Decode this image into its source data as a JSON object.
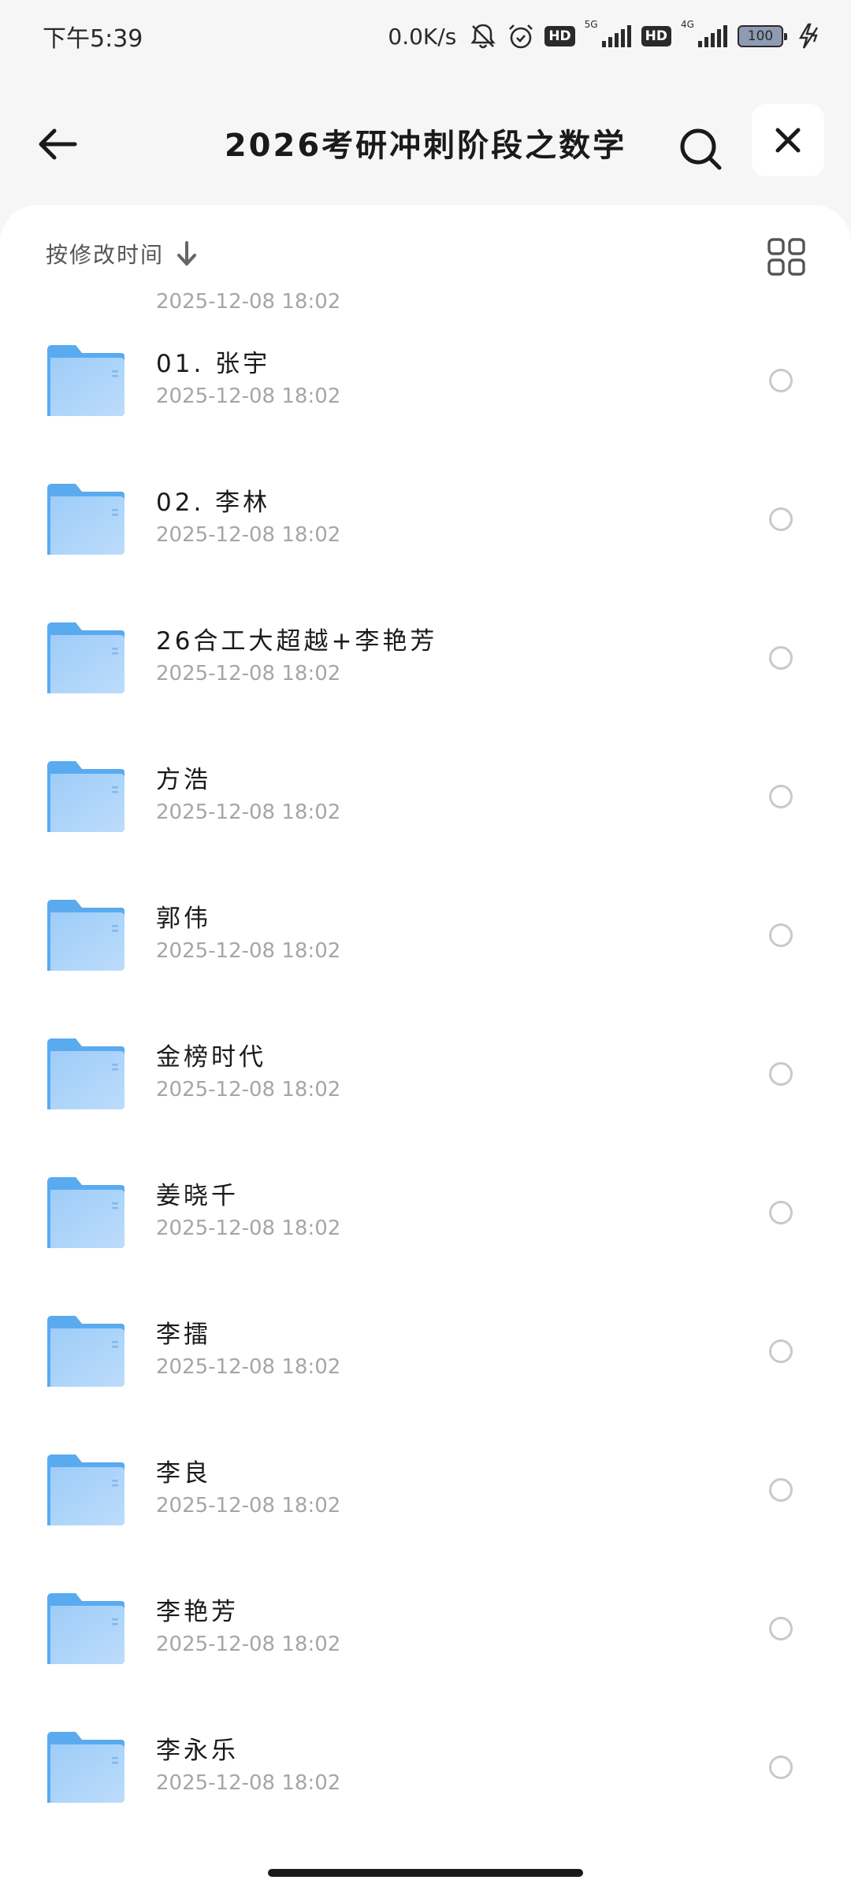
{
  "status_bar": {
    "time": "下午5:39",
    "net_speed": "0.0K/s",
    "network_1": "5G",
    "network_2": "4G",
    "hd_label": "HD",
    "battery": "100",
    "icons": [
      "mute-bell-icon",
      "alarm-icon",
      "signal-icon",
      "battery-icon",
      "charging-icon"
    ]
  },
  "header": {
    "title": "2026考研冲刺阶段之数学",
    "back_icon": "arrow-left-icon",
    "search_icon": "search-icon",
    "close_icon": "close-icon"
  },
  "toolbar": {
    "sort_label": "按修改时间",
    "sort_icon": "arrow-down-icon",
    "view_icon": "grid-view-icon"
  },
  "list": {
    "clipped_date": "2025-12-08  18:02",
    "items": [
      {
        "name": "01. 张宇",
        "date": "2025-12-08  18:02"
      },
      {
        "name": "02. 李林",
        "date": "2025-12-08  18:02"
      },
      {
        "name": "26合工大超越+李艳芳",
        "date": "2025-12-08  18:02"
      },
      {
        "name": "方浩",
        "date": "2025-12-08  18:02"
      },
      {
        "name": "郭伟",
        "date": "2025-12-08  18:02"
      },
      {
        "name": "金榜时代",
        "date": "2025-12-08  18:02"
      },
      {
        "name": "姜晓千",
        "date": "2025-12-08  18:02"
      },
      {
        "name": "李擂",
        "date": "2025-12-08  18:02"
      },
      {
        "name": "李良",
        "date": "2025-12-08  18:02"
      },
      {
        "name": "李艳芳",
        "date": "2025-12-08  18:02"
      },
      {
        "name": "李永乐",
        "date": "2025-12-08  18:02"
      }
    ]
  },
  "colors": {
    "folder_back": "#5aaaf0",
    "folder_front": "#9dccf8",
    "background": "#f6f6f6",
    "sheet": "#ffffff"
  }
}
